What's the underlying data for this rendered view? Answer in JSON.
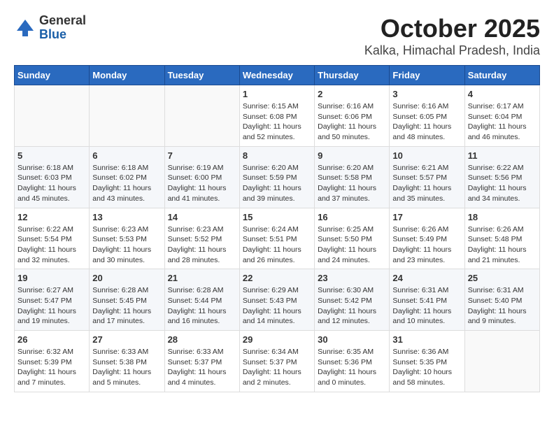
{
  "header": {
    "logo_general": "General",
    "logo_blue": "Blue",
    "title": "October 2025",
    "subtitle": "Kalka, Himachal Pradesh, India"
  },
  "weekdays": [
    "Sunday",
    "Monday",
    "Tuesday",
    "Wednesday",
    "Thursday",
    "Friday",
    "Saturday"
  ],
  "rows": [
    [
      {
        "day": "",
        "content": ""
      },
      {
        "day": "",
        "content": ""
      },
      {
        "day": "",
        "content": ""
      },
      {
        "day": "1",
        "content": "Sunrise: 6:15 AM\nSunset: 6:08 PM\nDaylight: 11 hours\nand 52 minutes."
      },
      {
        "day": "2",
        "content": "Sunrise: 6:16 AM\nSunset: 6:06 PM\nDaylight: 11 hours\nand 50 minutes."
      },
      {
        "day": "3",
        "content": "Sunrise: 6:16 AM\nSunset: 6:05 PM\nDaylight: 11 hours\nand 48 minutes."
      },
      {
        "day": "4",
        "content": "Sunrise: 6:17 AM\nSunset: 6:04 PM\nDaylight: 11 hours\nand 46 minutes."
      }
    ],
    [
      {
        "day": "5",
        "content": "Sunrise: 6:18 AM\nSunset: 6:03 PM\nDaylight: 11 hours\nand 45 minutes."
      },
      {
        "day": "6",
        "content": "Sunrise: 6:18 AM\nSunset: 6:02 PM\nDaylight: 11 hours\nand 43 minutes."
      },
      {
        "day": "7",
        "content": "Sunrise: 6:19 AM\nSunset: 6:00 PM\nDaylight: 11 hours\nand 41 minutes."
      },
      {
        "day": "8",
        "content": "Sunrise: 6:20 AM\nSunset: 5:59 PM\nDaylight: 11 hours\nand 39 minutes."
      },
      {
        "day": "9",
        "content": "Sunrise: 6:20 AM\nSunset: 5:58 PM\nDaylight: 11 hours\nand 37 minutes."
      },
      {
        "day": "10",
        "content": "Sunrise: 6:21 AM\nSunset: 5:57 PM\nDaylight: 11 hours\nand 35 minutes."
      },
      {
        "day": "11",
        "content": "Sunrise: 6:22 AM\nSunset: 5:56 PM\nDaylight: 11 hours\nand 34 minutes."
      }
    ],
    [
      {
        "day": "12",
        "content": "Sunrise: 6:22 AM\nSunset: 5:54 PM\nDaylight: 11 hours\nand 32 minutes."
      },
      {
        "day": "13",
        "content": "Sunrise: 6:23 AM\nSunset: 5:53 PM\nDaylight: 11 hours\nand 30 minutes."
      },
      {
        "day": "14",
        "content": "Sunrise: 6:23 AM\nSunset: 5:52 PM\nDaylight: 11 hours\nand 28 minutes."
      },
      {
        "day": "15",
        "content": "Sunrise: 6:24 AM\nSunset: 5:51 PM\nDaylight: 11 hours\nand 26 minutes."
      },
      {
        "day": "16",
        "content": "Sunrise: 6:25 AM\nSunset: 5:50 PM\nDaylight: 11 hours\nand 24 minutes."
      },
      {
        "day": "17",
        "content": "Sunrise: 6:26 AM\nSunset: 5:49 PM\nDaylight: 11 hours\nand 23 minutes."
      },
      {
        "day": "18",
        "content": "Sunrise: 6:26 AM\nSunset: 5:48 PM\nDaylight: 11 hours\nand 21 minutes."
      }
    ],
    [
      {
        "day": "19",
        "content": "Sunrise: 6:27 AM\nSunset: 5:47 PM\nDaylight: 11 hours\nand 19 minutes."
      },
      {
        "day": "20",
        "content": "Sunrise: 6:28 AM\nSunset: 5:45 PM\nDaylight: 11 hours\nand 17 minutes."
      },
      {
        "day": "21",
        "content": "Sunrise: 6:28 AM\nSunset: 5:44 PM\nDaylight: 11 hours\nand 16 minutes."
      },
      {
        "day": "22",
        "content": "Sunrise: 6:29 AM\nSunset: 5:43 PM\nDaylight: 11 hours\nand 14 minutes."
      },
      {
        "day": "23",
        "content": "Sunrise: 6:30 AM\nSunset: 5:42 PM\nDaylight: 11 hours\nand 12 minutes."
      },
      {
        "day": "24",
        "content": "Sunrise: 6:31 AM\nSunset: 5:41 PM\nDaylight: 11 hours\nand 10 minutes."
      },
      {
        "day": "25",
        "content": "Sunrise: 6:31 AM\nSunset: 5:40 PM\nDaylight: 11 hours\nand 9 minutes."
      }
    ],
    [
      {
        "day": "26",
        "content": "Sunrise: 6:32 AM\nSunset: 5:39 PM\nDaylight: 11 hours\nand 7 minutes."
      },
      {
        "day": "27",
        "content": "Sunrise: 6:33 AM\nSunset: 5:38 PM\nDaylight: 11 hours\nand 5 minutes."
      },
      {
        "day": "28",
        "content": "Sunrise: 6:33 AM\nSunset: 5:37 PM\nDaylight: 11 hours\nand 4 minutes."
      },
      {
        "day": "29",
        "content": "Sunrise: 6:34 AM\nSunset: 5:37 PM\nDaylight: 11 hours\nand 2 minutes."
      },
      {
        "day": "30",
        "content": "Sunrise: 6:35 AM\nSunset: 5:36 PM\nDaylight: 11 hours\nand 0 minutes."
      },
      {
        "day": "31",
        "content": "Sunrise: 6:36 AM\nSunset: 5:35 PM\nDaylight: 10 hours\nand 58 minutes."
      },
      {
        "day": "",
        "content": ""
      }
    ]
  ]
}
